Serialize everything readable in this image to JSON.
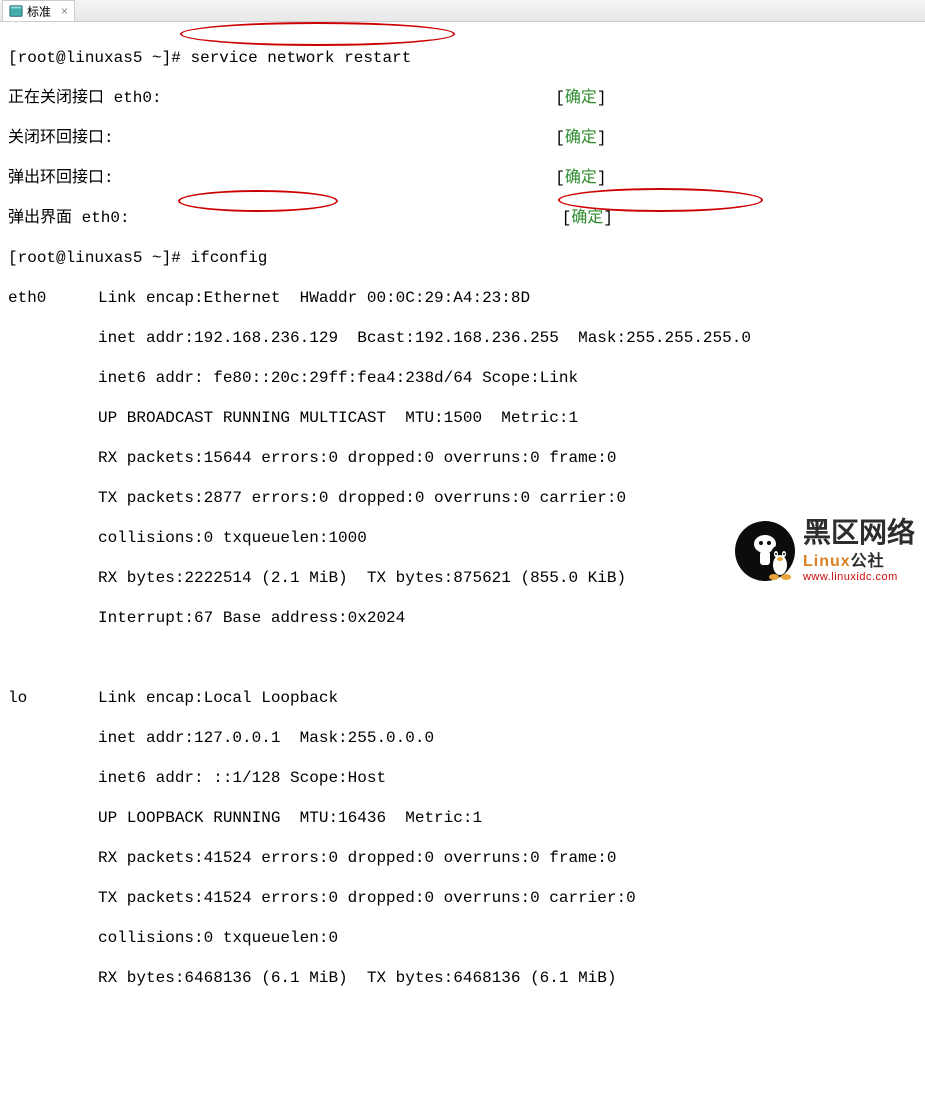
{
  "tab": {
    "label": "标准",
    "close": "×"
  },
  "prompt": {
    "user_host": "root@linuxas5",
    "path": "~",
    "symbol": "#"
  },
  "commands": {
    "restart": "service network restart",
    "ifconfig": "ifconfig"
  },
  "restart_output": {
    "line1_label": "正在关闭接口 eth0:",
    "line2_label": "关闭环回接口:",
    "line3_label": "弹出环回接口:",
    "line4_label": "弹出界面 eth0:",
    "status_open": "[",
    "status_ok": "确定",
    "status_close": "]"
  },
  "eth0": {
    "name": "eth0",
    "link": "Link encap:Ethernet  HWaddr 00:0C:29:A4:23:8D",
    "inet_prefix": "inet addr:",
    "inet_ip": "192.168.236.129",
    "inet_bcast": "  Bcast:192.168.236.255  ",
    "inet_mask_label": "Mask:",
    "inet_mask": "255.255.255.0",
    "inet6": "inet6 addr: fe80::20c:29ff:fea4:238d/64 Scope:Link",
    "flags": "UP BROADCAST RUNNING MULTICAST  MTU:1500  Metric:1",
    "rx_packets": "RX packets:15644 errors:0 dropped:0 overruns:0 frame:0",
    "tx_packets": "TX packets:2877 errors:0 dropped:0 overruns:0 carrier:0",
    "collisions": "collisions:0 txqueuelen:1000",
    "bytes": "RX bytes:2222514 (2.1 MiB)  TX bytes:875621 (855.0 KiB)",
    "interrupt": "Interrupt:67 Base address:0x2024"
  },
  "lo": {
    "name": "lo",
    "link": "Link encap:Local Loopback",
    "inet": "inet addr:127.0.0.1  Mask:255.0.0.0",
    "inet6": "inet6 addr: ::1/128 Scope:Host",
    "flags": "UP LOOPBACK RUNNING  MTU:16436  Metric:1",
    "rx_packets": "RX packets:41524 errors:0 dropped:0 overruns:0 frame:0",
    "tx_packets": "TX packets:41524 errors:0 dropped:0 overruns:0 carrier:0",
    "collisions": "collisions:0 txqueuelen:0",
    "bytes": "RX bytes:6468136 (6.1 MiB)  TX bytes:6468136 (6.1 MiB)"
  },
  "watermark": {
    "main1": "黑区",
    "main2": "网络",
    "sub": "Linux",
    "sub2": "公社",
    "url": "www.linuxidc.com"
  }
}
